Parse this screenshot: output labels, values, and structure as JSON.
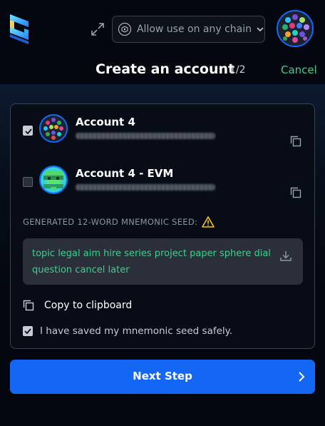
{
  "header": {
    "chain_selector_label": "Allow use on any chain",
    "title": "Create an account",
    "step": "1/2",
    "cancel_label": "Cancel"
  },
  "accounts": [
    {
      "name": "Account 4",
      "checked": true
    },
    {
      "name": "Account 4 - EVM",
      "checked": false
    }
  ],
  "seed": {
    "label": "GENERATED 12-WORD MNEMONIC SEED:",
    "phrase": "topic legal aim hire series project paper sphere dial question cancel later"
  },
  "copy_label": "Copy to clipboard",
  "saved_label": "I have saved my mnemonic seed safely.",
  "saved_checked": true,
  "next_label": "Next Step",
  "colors": {
    "accent_green": "#3ecf8e",
    "primary_blue": "#1466f5",
    "warning_yellow": "#f5c518"
  },
  "icons": [
    "logo-icon",
    "expand-icon",
    "network-icon",
    "chevron-down-icon",
    "copy-icon",
    "warning-icon",
    "download-icon",
    "chevron-right-icon"
  ]
}
